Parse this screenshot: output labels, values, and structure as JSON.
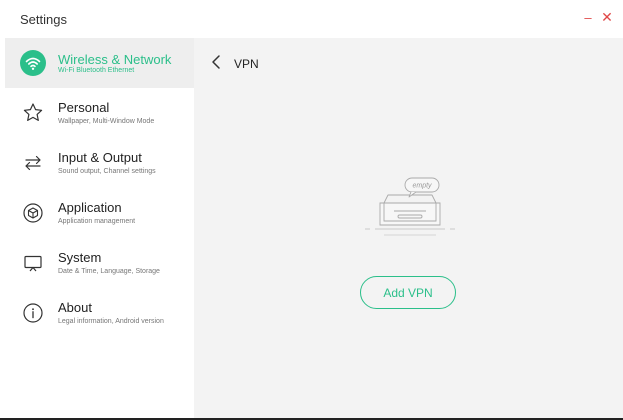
{
  "window": {
    "title": "Settings",
    "minimize_glyph": "–",
    "close_glyph": "✕",
    "accent": "#2bbf8a",
    "control_color": "#e04848"
  },
  "sidebar": {
    "items": [
      {
        "label": "Wireless & Network",
        "sub": "Wi-Fi Bluetooth Ethernet",
        "icon": "wifi-icon",
        "active": true
      },
      {
        "label": "Personal",
        "sub": "Wallpaper, Multi-Window Mode",
        "icon": "star-icon",
        "active": false
      },
      {
        "label": "Input & Output",
        "sub": "Sound output, Channel settings",
        "icon": "swap-arrows-icon",
        "active": false
      },
      {
        "label": "Application",
        "sub": "Application management",
        "icon": "cube-icon",
        "active": false
      },
      {
        "label": "System",
        "sub": "Date & Time, Language, Storage",
        "icon": "monitor-icon",
        "active": false
      },
      {
        "label": "About",
        "sub": "Legal information, Android version",
        "icon": "info-icon",
        "active": false
      }
    ]
  },
  "main": {
    "title": "VPN",
    "back_icon": "chevron-left-icon",
    "empty_icon": "empty-tray-icon",
    "empty_text": "empty",
    "add_button": "Add VPN"
  }
}
